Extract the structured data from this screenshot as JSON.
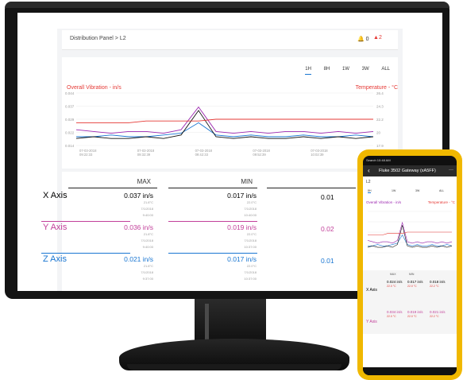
{
  "breadcrumb": "Distribution Panel > L2",
  "notifications": {
    "bell": "0",
    "alert": "2"
  },
  "time_tabs": [
    "1H",
    "8H",
    "1W",
    "3W",
    "ALL"
  ],
  "chart_labels": {
    "left": "Overall Vibration - in/s",
    "right": "Temperature - °C"
  },
  "chart_data": {
    "type": "line",
    "x": [
      "07-03-2018 09:22:33",
      "07-03-2018 09:32:39",
      "07-03-2018 09:42:33",
      "07-03-2018 09:52:39",
      "07-03-2018 10:02:39",
      "07-03-2018 10:12:33"
    ],
    "ylim_left": [
      0.014,
      0.044
    ],
    "yticks_left": [
      "0.044",
      "0.037",
      "0.029",
      "0.022",
      "0.014"
    ],
    "yticks_right": [
      "26.4",
      "24.3",
      "22.2",
      "20",
      "17.9"
    ],
    "series": [
      {
        "values": [
          0.023,
          0.022,
          0.021,
          0.022,
          0.022,
          0.021,
          0.023,
          0.036,
          0.022,
          0.021,
          0.022,
          0.021,
          0.022,
          0.022,
          0.021,
          0.022,
          0.021,
          0.022
        ],
        "color": "#9c27b0"
      },
      {
        "values": [
          0.019,
          0.019,
          0.02,
          0.019,
          0.019,
          0.02,
          0.021,
          0.027,
          0.02,
          0.019,
          0.02,
          0.019,
          0.019,
          0.02,
          0.019,
          0.019,
          0.02,
          0.019
        ],
        "color": "#1976d2"
      },
      {
        "values": [
          0.018,
          0.019,
          0.018,
          0.018,
          0.019,
          0.018,
          0.02,
          0.034,
          0.019,
          0.018,
          0.019,
          0.018,
          0.018,
          0.019,
          0.018,
          0.019,
          0.018,
          0.019
        ],
        "color": "#111111"
      },
      {
        "values": [
          0.027,
          0.027,
          0.027,
          0.027,
          0.028,
          0.028,
          0.028,
          0.028,
          0.029,
          0.029,
          0.029,
          0.029,
          0.029,
          0.029,
          0.029,
          0.029,
          0.029,
          0.029
        ],
        "color": "#e53935"
      }
    ]
  },
  "table": {
    "headers": [
      "MAX",
      "MIN"
    ],
    "rows": [
      {
        "axis": "X Axis",
        "color": "#111111",
        "cells": [
          {
            "value": "0.037 in/s",
            "temp": "21.8°C",
            "date": "7/1/2018",
            "time": "9:40:00"
          },
          {
            "value": "0.017 in/s",
            "temp": "22.0°C",
            "date": "7/1/2018",
            "time": "10:40:00"
          }
        ]
      },
      {
        "axis": "Y Axis",
        "color": "#c2409a",
        "cells": [
          {
            "value": "0.036 in/s",
            "temp": "21.8°C",
            "date": "7/1/2018",
            "time": "9:40:00"
          },
          {
            "value": "0.019 in/s",
            "temp": "22.0°C",
            "date": "7/1/2018",
            "time": "10:37:00"
          }
        ]
      },
      {
        "axis": "Z Axis",
        "color": "#1976d2",
        "cells": [
          {
            "value": "0.021 in/s",
            "temp": "21.8°C",
            "date": "7/1/2018",
            "time": "9:37:00"
          },
          {
            "value": "0.017 in/s",
            "temp": "22.0°C",
            "date": "7/1/2018",
            "time": "10:37:00"
          }
        ]
      }
    ],
    "partial_values": [
      "0.01",
      "0.02",
      "0.01"
    ]
  },
  "phone": {
    "status": "Search 10:48 AM",
    "title": "Fluke 3502 Gateway (xA5FF)",
    "menu": "···",
    "subtitle": "L2",
    "tabs": [
      "8H",
      "1W",
      "3W",
      "ALL"
    ],
    "chart_labels": {
      "left": "Overall Vibration - in/s",
      "right": "Temperature - °C"
    },
    "headers": [
      "MAX",
      "MIN",
      ""
    ],
    "rows": [
      {
        "axis": "X Axis",
        "values": [
          "0.024 in/s",
          "0.017 in/s",
          "0.018 in/s"
        ],
        "temps": [
          "22.0 °C",
          "22.0 °C",
          "22.2 °C"
        ]
      },
      {
        "axis": "Y Axis",
        "values": [
          "0.034 in/s",
          "0.019 in/s",
          "0.021 in/s"
        ],
        "temps": [
          "22.0 °C",
          "22.0 °C",
          "22.2 °C"
        ]
      }
    ]
  }
}
